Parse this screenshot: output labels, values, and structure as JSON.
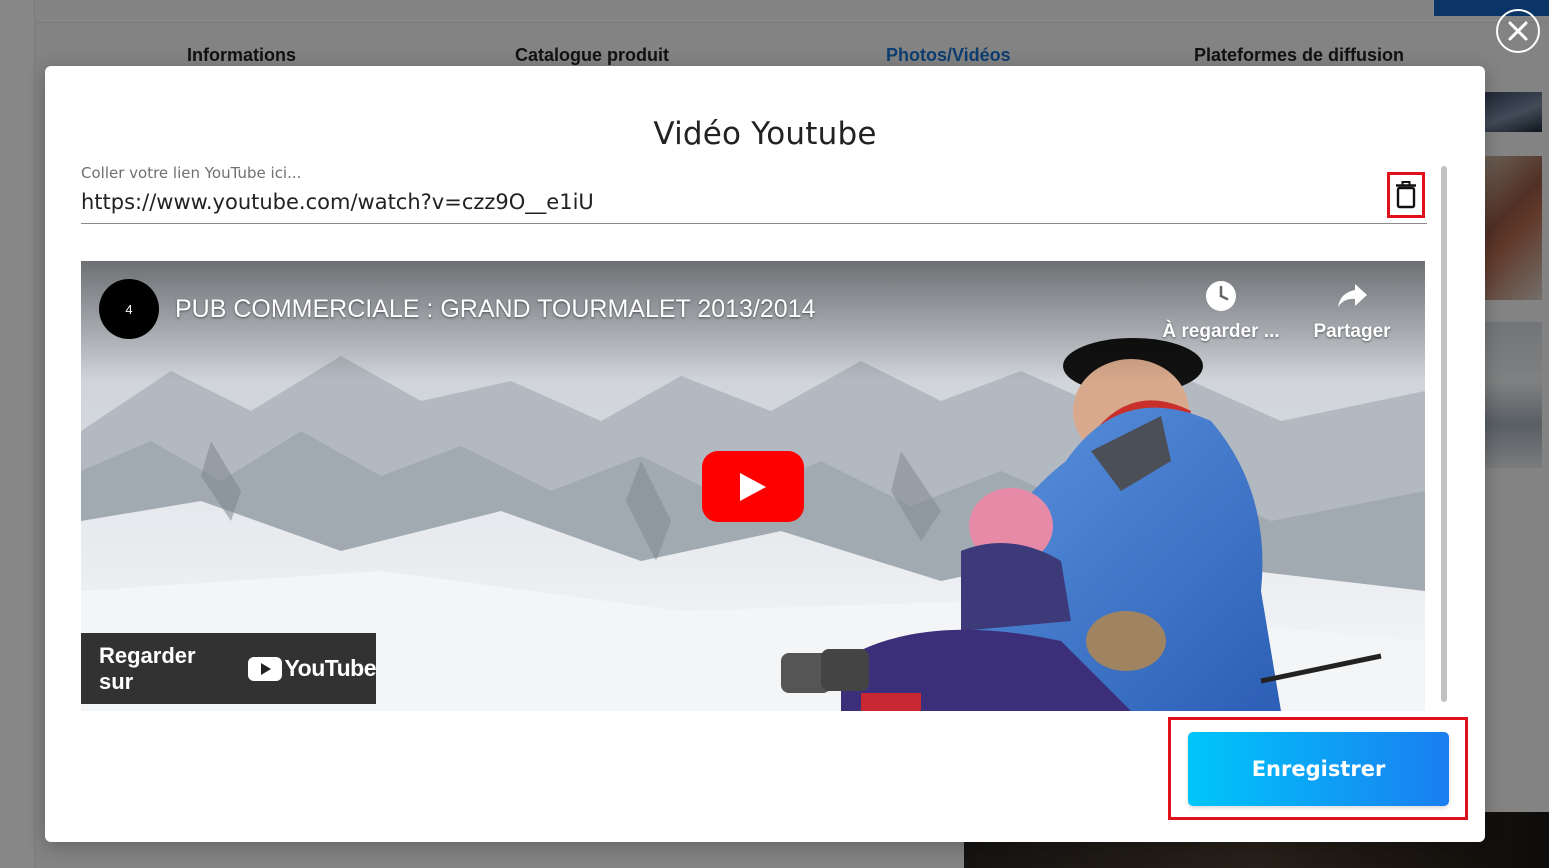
{
  "tabs": [
    {
      "label": "Informations",
      "active": false
    },
    {
      "label": "Catalogue produit",
      "active": false
    },
    {
      "label": "Photos/Vidéos",
      "active": true
    },
    {
      "label": "Plateformes de diffusion",
      "active": false
    }
  ],
  "modal": {
    "title": "Vidéo Youtube",
    "field_label": "Coller votre lien YouTube ici...",
    "url_value": "https://www.youtube.com/watch?v=czz9O__e1iU",
    "save_label": "Enregistrer"
  },
  "video": {
    "channel_avatar_text": "4",
    "title": "PUB COMMERCIALE : GRAND TOURMALET 2013/2014",
    "watch_later_label": "À regarder ...",
    "share_label": "Partager",
    "watch_on_label": "Regarder sur",
    "youtube_wordmark": "YouTube"
  },
  "icons": {
    "close": "close-icon",
    "trash": "trash-icon",
    "clock": "clock-icon",
    "share": "share-arrow-icon",
    "play": "play-icon"
  },
  "colors": {
    "active_tab": "#1976d2",
    "highlight": "#e0111b",
    "button_gradient_start": "#00c6fb",
    "button_gradient_end": "#1a7ef0",
    "youtube_red": "#ff0000"
  }
}
